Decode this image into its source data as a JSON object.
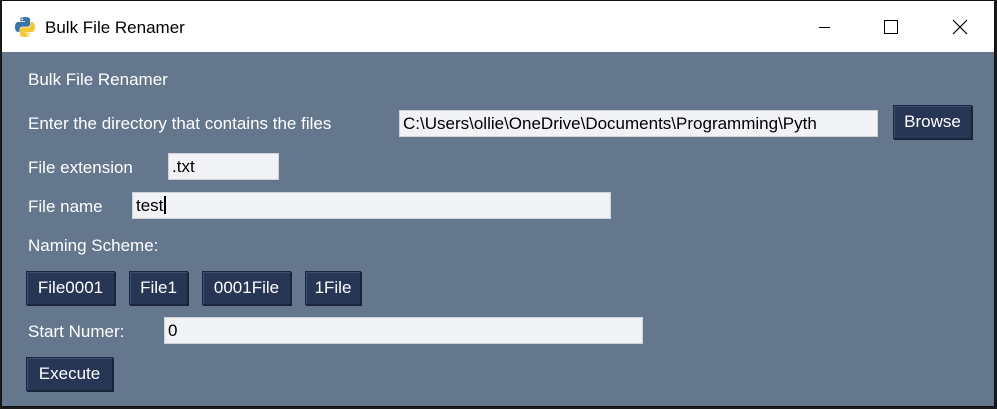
{
  "window": {
    "title": "Bulk File Renamer"
  },
  "main": {
    "heading": "Bulk File Renamer",
    "directory_label": "Enter the directory that contains the files",
    "directory_value": "C:\\Users\\ollie\\OneDrive\\Documents\\Programming\\Pyth",
    "browse_label": "Browse",
    "extension_label": "File extension",
    "extension_value": ".txt",
    "filename_label": "File name",
    "filename_value": "test",
    "naming_scheme_label": "Naming Scheme:",
    "scheme_buttons": [
      "File0001",
      "File1",
      "0001File",
      "1File"
    ],
    "start_label": "Start Numer:",
    "start_value": "0",
    "execute_label": "Execute"
  },
  "colors": {
    "background": "#64778d",
    "button": "#283655",
    "entry": "#f0f2f5"
  }
}
